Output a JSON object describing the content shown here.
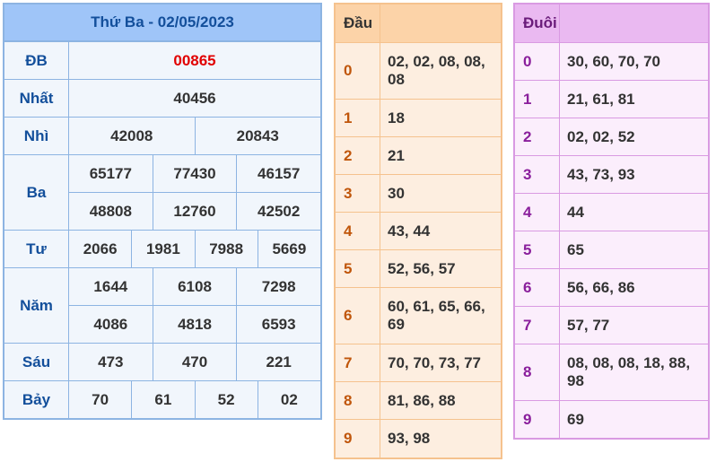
{
  "results": {
    "title": "Thứ Ba - 02/05/2023",
    "prizes": [
      {
        "label": "ĐB",
        "lines": [
          [
            "00865"
          ]
        ]
      },
      {
        "label": "Nhất",
        "lines": [
          [
            "40456"
          ]
        ]
      },
      {
        "label": "Nhì",
        "lines": [
          [
            "42008",
            "20843"
          ]
        ]
      },
      {
        "label": "Ba",
        "lines": [
          [
            "65177",
            "77430",
            "46157"
          ],
          [
            "48808",
            "12760",
            "42502"
          ]
        ]
      },
      {
        "label": "Tư",
        "lines": [
          [
            "2066",
            "1981",
            "7988",
            "5669"
          ]
        ]
      },
      {
        "label": "Năm",
        "lines": [
          [
            "1644",
            "6108",
            "7298"
          ],
          [
            "4086",
            "4818",
            "6593"
          ]
        ]
      },
      {
        "label": "Sáu",
        "lines": [
          [
            "473",
            "470",
            "221"
          ]
        ]
      },
      {
        "label": "Bảy",
        "lines": [
          [
            "70",
            "61",
            "52",
            "02"
          ]
        ]
      }
    ]
  },
  "head_table": {
    "header_key": "Đầu",
    "header_value": "",
    "rows": [
      {
        "key": "0",
        "value": "02, 02, 08, 08, 08"
      },
      {
        "key": "1",
        "value": "18"
      },
      {
        "key": "2",
        "value": "21"
      },
      {
        "key": "3",
        "value": "30"
      },
      {
        "key": "4",
        "value": "43, 44"
      },
      {
        "key": "5",
        "value": "52, 56, 57"
      },
      {
        "key": "6",
        "value": "60, 61, 65, 66, 69"
      },
      {
        "key": "7",
        "value": "70, 70, 73, 77"
      },
      {
        "key": "8",
        "value": "81, 86, 88"
      },
      {
        "key": "9",
        "value": "93, 98"
      }
    ]
  },
  "tail_table": {
    "header_key": "Đuôi",
    "header_value": "",
    "rows": [
      {
        "key": "0",
        "value": "30, 60, 70, 70"
      },
      {
        "key": "1",
        "value": "21, 61, 81"
      },
      {
        "key": "2",
        "value": "02, 02, 52"
      },
      {
        "key": "3",
        "value": "43, 73, 93"
      },
      {
        "key": "4",
        "value": "44"
      },
      {
        "key": "5",
        "value": "65"
      },
      {
        "key": "6",
        "value": "56, 66, 86"
      },
      {
        "key": "7",
        "value": "57, 77"
      },
      {
        "key": "8",
        "value": "08, 08, 08, 18, 88, 98"
      },
      {
        "key": "9",
        "value": "69"
      }
    ]
  },
  "colors": {
    "special_prize": "#e10000",
    "results_header": "#9fc5f8",
    "head_header": "#fcd3a8",
    "tail_header": "#eab9f1"
  }
}
